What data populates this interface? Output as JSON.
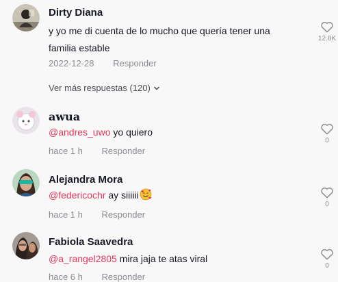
{
  "comments": [
    {
      "username": "Dirty Diana",
      "text_line1": "y yo me di cuenta de lo mucho que quería tener una",
      "text_line2": "familia estable",
      "date": "2022-12-28",
      "reply_label": "Responder",
      "likes": "12.8K"
    },
    {
      "username": "awua",
      "mention": "@andres_uwo",
      "text": " yo quiero",
      "date": "hace 1 h",
      "reply_label": "Responder",
      "likes": "0"
    },
    {
      "username": "Alejandra Mora",
      "mention": "@federicochr",
      "text": " ay siiiiii",
      "emoji": "smiling-face-with-hearts",
      "date": "hace 1 h",
      "reply_label": "Responder",
      "likes": "0"
    },
    {
      "username": "Fabiola Saavedra",
      "mention": "@a_rangel2805",
      "text": " mira jaja te atas viral",
      "date": "hace 6 h",
      "reply_label": "Responder",
      "likes": "0"
    }
  ],
  "view_more_replies": "Ver más respuestas (120)",
  "colors": {
    "mention": "#e3385c",
    "meta": "#8a8b91",
    "background": "#f8f8f8"
  },
  "icons": {
    "like": "heart-outline-icon",
    "expand": "chevron-down-icon"
  }
}
